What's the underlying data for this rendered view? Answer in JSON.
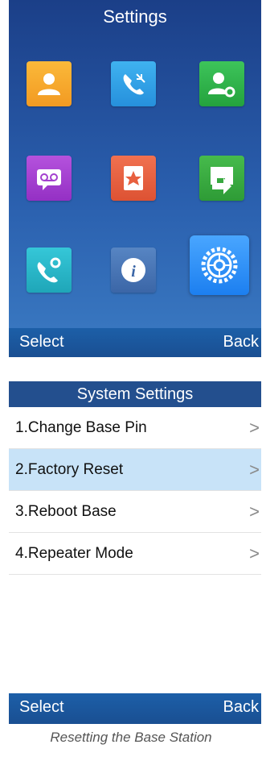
{
  "screen1": {
    "title": "Settings",
    "icons": [
      {
        "name": "contacts-icon",
        "color": "#f6a52b"
      },
      {
        "name": "call-history-icon",
        "color": "#2f9fe3"
      },
      {
        "name": "contact-settings-icon",
        "color": "#2fb24a"
      },
      {
        "name": "voicemail-icon",
        "color": "#a340cf"
      },
      {
        "name": "favorites-icon",
        "color": "#e8603f"
      },
      {
        "name": "call-forward-icon",
        "color": "#36a83f"
      },
      {
        "name": "call-settings-icon",
        "color": "#2ab6c9"
      },
      {
        "name": "info-icon",
        "color": "#4a76b5"
      },
      {
        "name": "settings-gear-icon",
        "color": "#2a8df6",
        "selected": true
      }
    ],
    "softkeys": {
      "left": "Select",
      "right": "Back"
    }
  },
  "screen2": {
    "title": "System Settings",
    "items": [
      {
        "label": "1.Change Base Pin"
      },
      {
        "label": "2.Factory Reset",
        "selected": true
      },
      {
        "label": "3.Reboot Base"
      },
      {
        "label": "4.Repeater Mode"
      }
    ],
    "chevron": ">",
    "softkeys": {
      "left": "Select",
      "right": "Back"
    }
  },
  "caption": "Resetting the Base Station"
}
